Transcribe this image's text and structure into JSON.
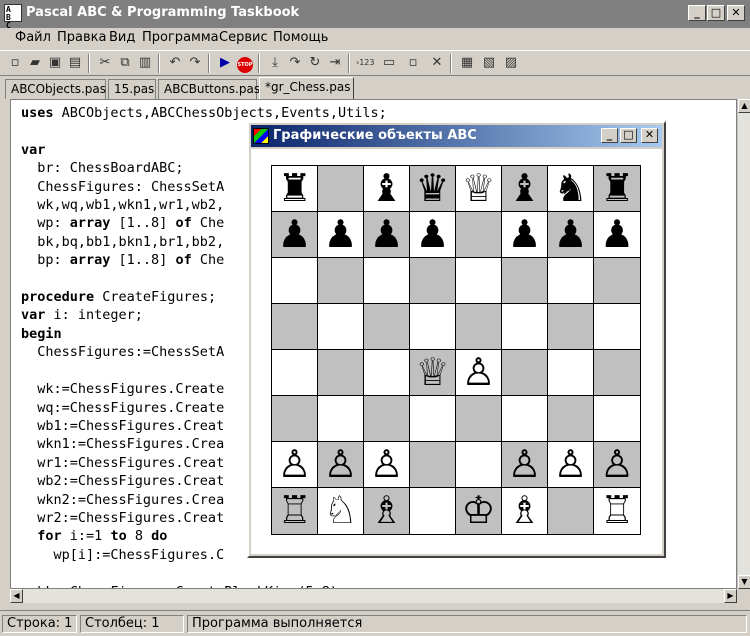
{
  "window": {
    "title": "Pascal ABC & Programming Taskbook"
  },
  "menu": [
    "Файл",
    "Правка",
    "Вид",
    "Программа",
    "Сервис",
    "Помощь"
  ],
  "toolbar": [
    "new-icon",
    "open-icon",
    "save-icon",
    "save-all-icon",
    "cut-icon",
    "copy-icon",
    "paste-icon",
    "undo-icon",
    "redo-icon",
    "run-icon",
    "stop-icon",
    "step-into-icon",
    "step-over-icon",
    "step-out-icon",
    "run-to-cursor-icon",
    "counter-icon",
    "window-icon",
    "watch-icon",
    "close-icon",
    "task-icon",
    "task2-icon",
    "task3-icon"
  ],
  "tabs": [
    "ABCObjects.pas",
    "15.pas",
    "ABCButtons.pas",
    "*gr_Chess.pas"
  ],
  "code": [
    [
      [
        "b",
        "uses"
      ],
      [
        "n",
        " ABCObjects,ABCChessObjects,Events,Utils;"
      ]
    ],
    [
      [
        "n",
        ""
      ]
    ],
    [
      [
        "b",
        "var"
      ]
    ],
    [
      [
        "n",
        "  br: ChessBoardABC;"
      ]
    ],
    [
      [
        "n",
        "  ChessFigures: ChessSetA"
      ]
    ],
    [
      [
        "n",
        "  wk,wq,wb1,wkn1,wr1,wb2,"
      ]
    ],
    [
      [
        "n",
        "  wp: "
      ],
      [
        "b",
        "array"
      ],
      [
        "n",
        " [1..8] "
      ],
      [
        "b",
        "of"
      ],
      [
        "n",
        " Che"
      ]
    ],
    [
      [
        "n",
        "  bk,bq,bb1,bkn1,br1,bb2,"
      ]
    ],
    [
      [
        "n",
        "  bp: "
      ],
      [
        "b",
        "array"
      ],
      [
        "n",
        " [1..8] "
      ],
      [
        "b",
        "of"
      ],
      [
        "n",
        " Che"
      ]
    ],
    [
      [
        "n",
        ""
      ]
    ],
    [
      [
        "b",
        "procedure"
      ],
      [
        "n",
        " CreateFigures;"
      ]
    ],
    [
      [
        "b",
        "var"
      ],
      [
        "n",
        " i: integer;"
      ]
    ],
    [
      [
        "b",
        "begin"
      ]
    ],
    [
      [
        "n",
        "  ChessFigures:=ChessSetA                           ,45,br)"
      ]
    ],
    [
      [
        "n",
        ""
      ]
    ],
    [
      [
        "n",
        "  wk:=ChessFigures.Create"
      ]
    ],
    [
      [
        "n",
        "  wq:=ChessFigures.Create"
      ]
    ],
    [
      [
        "n",
        "  wb1:=ChessFigures.Creat"
      ]
    ],
    [
      [
        "n",
        "  wkn1:=ChessFigures.Crea"
      ]
    ],
    [
      [
        "n",
        "  wr1:=ChessFigures.Creat"
      ]
    ],
    [
      [
        "n",
        "  wb2:=ChessFigures.Creat"
      ]
    ],
    [
      [
        "n",
        "  wkn2:=ChessFigures.Crea"
      ]
    ],
    [
      [
        "n",
        "  wr2:=ChessFigures.Creat"
      ]
    ],
    [
      [
        "n",
        "  "
      ],
      [
        "b",
        "for"
      ],
      [
        "n",
        " i:=1 "
      ],
      [
        "b",
        "to"
      ],
      [
        "n",
        " 8 "
      ],
      [
        "b",
        "do"
      ]
    ],
    [
      [
        "n",
        "    wp[i]:=ChessFigures.C"
      ]
    ],
    [
      [
        "n",
        ""
      ]
    ],
    [
      [
        "n",
        "  bk:=ChessFigures.CreateBlackKing(5,8);"
      ]
    ]
  ],
  "status": {
    "row": "Строка: 1",
    "col": "Столбец: 1",
    "state": "Программа выполняется"
  },
  "graphics": {
    "title": "Графические объекты ABC",
    "board": [
      [
        "♜",
        "",
        "♝",
        "♛",
        "♕",
        "♝",
        "♞",
        "♜"
      ],
      [
        "♟",
        "♟",
        "♟",
        "♟",
        "",
        "♟",
        "♟",
        "♟"
      ],
      [
        "",
        "",
        "",
        "",
        "",
        "",
        "",
        ""
      ],
      [
        "",
        "",
        "",
        "",
        "",
        "",
        "",
        ""
      ],
      [
        "",
        "",
        "",
        "♕",
        "♙",
        "",
        "",
        ""
      ],
      [
        "",
        "",
        "",
        "",
        "",
        "",
        "",
        ""
      ],
      [
        "♙",
        "♙",
        "♙",
        "",
        "",
        "♙",
        "♙",
        "♙"
      ],
      [
        "♖",
        "♘",
        "♗",
        "",
        "♔",
        "♗",
        "",
        "♖"
      ]
    ]
  },
  "colors": {
    "title_bg": "#808080",
    "active_title_start": "#0a246a",
    "active_title_end": "#a6caf0",
    "dark_square": "#c0c0c0",
    "light_square": "#ffffff",
    "stop_red": "#dd0000",
    "run_blue": "#0000aa"
  }
}
